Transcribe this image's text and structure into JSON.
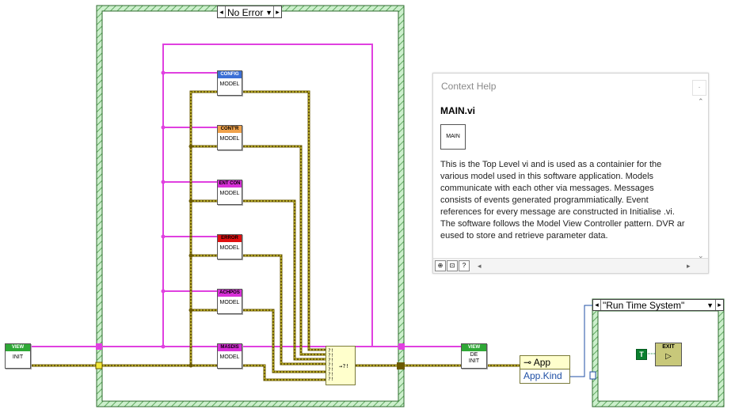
{
  "case_structure": {
    "selector_value": "No Error"
  },
  "subvis": [
    {
      "band": "CONFIG",
      "label": "MODEL",
      "band_color": "#3b6fd6"
    },
    {
      "band": "CONT'R",
      "label": "MODEL",
      "band_color": "#f0a24b"
    },
    {
      "band": "ENT CON",
      "label": "MODEL",
      "band_color": "#d830d8"
    },
    {
      "band": "ERROR",
      "label": "MODEL",
      "band_color": "#e01010"
    },
    {
      "band": "ACHPOS",
      "label": "MODEL",
      "band_color": "#d830d8"
    },
    {
      "band": "MASDIS",
      "label": "MODEL",
      "band_color": "#d830d8"
    }
  ],
  "view_init": {
    "band": "VIEW",
    "label": "INIT",
    "band_color": "#2fa836"
  },
  "view_deinit": {
    "band": "VIEW",
    "label1": "DE",
    "label2": "INIT",
    "band_color": "#2fa836"
  },
  "property_node": {
    "property": "App",
    "value": "App.Kind"
  },
  "case_structure_2": {
    "selector_value": "\"Run Time System\""
  },
  "exit_node": {
    "label": "EXIT"
  },
  "bool_const": {
    "label": "T"
  },
  "context_help": {
    "title": "Context Help",
    "vi_name": "MAIN.vi",
    "icon_text": "MAIN",
    "description": "This is the Top Level vi and is used as a containier for the various model used in this software application. Models communicate with each other via messages. Messages consists of events generated programmiatically. Event references for every message are constructed in Initialise .vi. The software follows the Model View Controller pattern. DVR ar eused to store and retrieve parameter data."
  },
  "colors": {
    "ref_wire": "#e040e0",
    "error_wire": "#7a7a00",
    "case_border": "#4d9a4d",
    "help_title": "#8a8a8a"
  }
}
